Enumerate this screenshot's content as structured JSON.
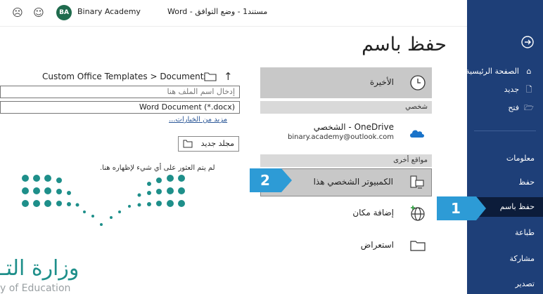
{
  "titlebar": {
    "frown_icon": "frown-face-icon",
    "smile_icon": "smile-face-icon",
    "avatar_initials": "BA",
    "user_name": "Binary Academy",
    "document_title": "مستند1 - وضع التوافق - Word"
  },
  "page_title": "حفظ باسم",
  "sidebar": {
    "back_icon": "back-arrow-icon",
    "items": [
      {
        "label": "الصفحة الرئيسية",
        "icon": "home-icon"
      },
      {
        "label": "جديد",
        "icon": "new-doc-icon"
      },
      {
        "label": "فتح",
        "icon": "folder-open-icon"
      },
      {
        "label": "معلومات"
      },
      {
        "label": "حفظ"
      },
      {
        "label": "حفظ باسم",
        "active": true
      },
      {
        "label": "طباعة"
      },
      {
        "label": "مشاركة"
      },
      {
        "label": "تصدير"
      }
    ]
  },
  "places": {
    "recent_label": "الأخيرة",
    "personal_header": "شخصي",
    "onedrive_label": "OneDrive - الشخصي",
    "onedrive_account": "binary.academy@outlook.com",
    "other_header": "مواقع أخرى",
    "this_pc_label": "الكمبيوتر الشخصي هذا",
    "add_place_label": "إضافة مكان",
    "browse_label": "استعراض"
  },
  "file_pane": {
    "path": "Custom Office Templates > Documents",
    "filename_placeholder": "إدخال اسم الملف هنا",
    "file_type": "Word Document (*.docx)",
    "more_options": "مزيد من الخيارات...",
    "new_folder": "مجلد جديد",
    "empty_message": "لم يتم العثور على أي شيء لإظهاره هنا."
  },
  "logo": {
    "arabic": "وزارة التـ",
    "english": "y of Education"
  },
  "callouts": {
    "one": "1",
    "two": "2"
  },
  "colors": {
    "sidebar": "#1e3f78",
    "sidebar_active": "#0c1c3a",
    "callout": "#2d9bd6",
    "logo_teal": "#1e8f8a"
  }
}
